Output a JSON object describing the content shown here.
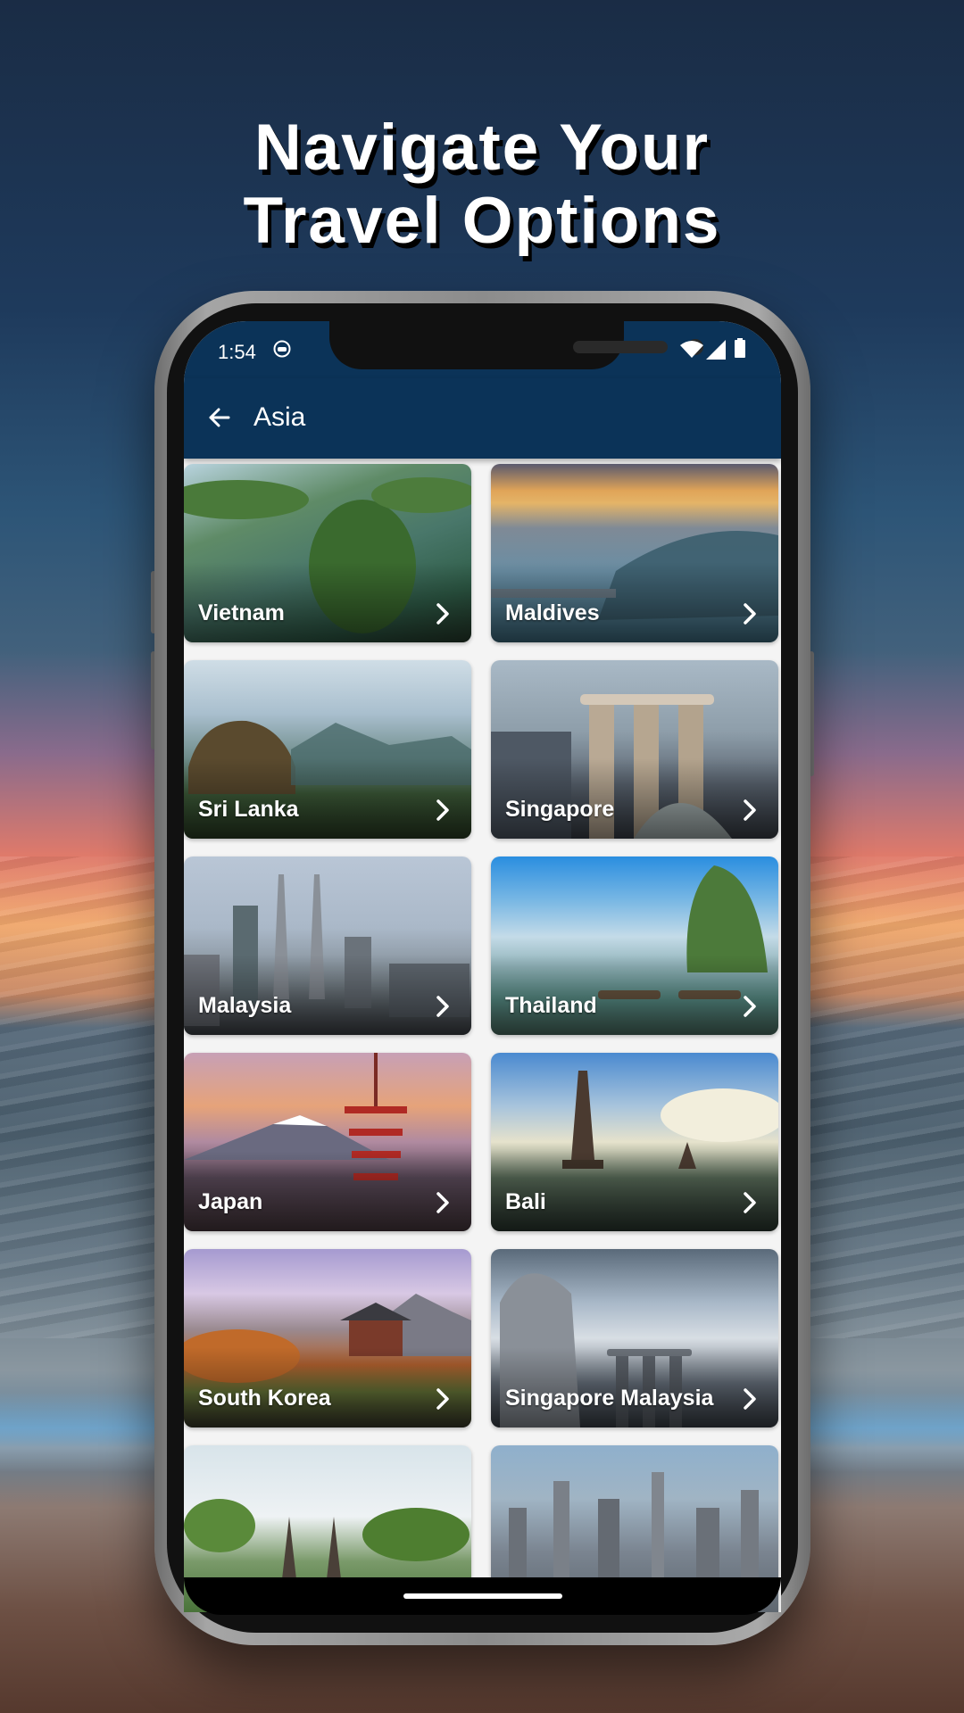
{
  "headline": {
    "line1": "Navigate Your",
    "line2": "Travel Options"
  },
  "status_bar": {
    "time": "1:54",
    "icons": [
      "face-icon",
      "wifi-icon",
      "signal-icon",
      "battery-icon"
    ]
  },
  "app_bar": {
    "back_icon": "arrow-left-icon",
    "title": "Asia",
    "color": "#0b3358"
  },
  "destinations": [
    {
      "name": "Vietnam"
    },
    {
      "name": "Maldives"
    },
    {
      "name": "Sri Lanka"
    },
    {
      "name": "Singapore"
    },
    {
      "name": "Malaysia"
    },
    {
      "name": "Thailand"
    },
    {
      "name": "Japan"
    },
    {
      "name": "Bali"
    },
    {
      "name": "South Korea"
    },
    {
      "name": "Singapore Malaysia"
    },
    {
      "name": ""
    },
    {
      "name": ""
    }
  ],
  "card_icon": "chevron-right-icon"
}
